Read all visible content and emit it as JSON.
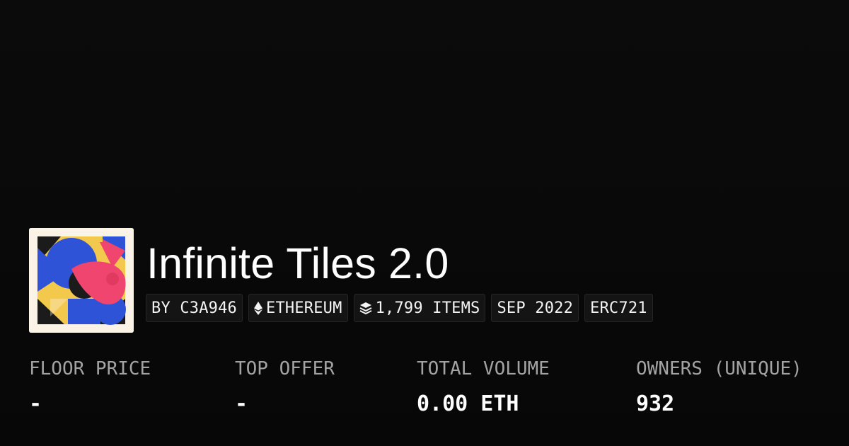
{
  "collection": {
    "title": "Infinite Tiles 2.0",
    "tags": {
      "creator": "BY C3A946",
      "chain": "ETHEREUM",
      "items": "1,799 ITEMS",
      "date": "SEP 2022",
      "standard": "ERC721"
    },
    "icons": {
      "chain": "ethereum-icon",
      "items": "layers-icon"
    }
  },
  "stats": {
    "floor_price": {
      "label": "FLOOR PRICE",
      "value": "-"
    },
    "top_offer": {
      "label": "TOP OFFER",
      "value": "-"
    },
    "total_volume": {
      "label": "TOTAL VOLUME",
      "value": "0.00 ETH"
    },
    "owners": {
      "label": "OWNERS (UNIQUE)",
      "value": "932"
    }
  },
  "colors": {
    "background": "#0b0b0b",
    "label": "#a3a3a3",
    "tag_background": "#141414",
    "artwork_blue": "#2f53d6",
    "artwork_yellow": "#f2c94c",
    "artwork_pink": "#f0456e"
  }
}
